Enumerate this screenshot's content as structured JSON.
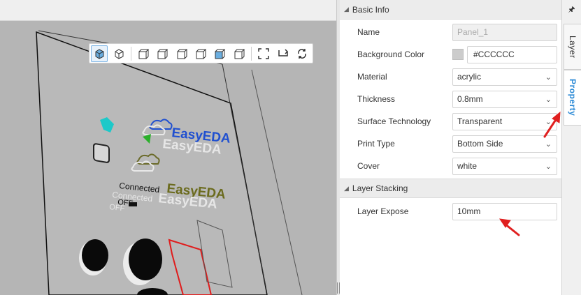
{
  "viewport": {
    "toolbar": {
      "buttons": [
        {
          "name": "view-3d-solid-icon",
          "active": true
        },
        {
          "name": "view-3d-wire-icon",
          "active": false
        },
        {
          "name": "view-front-icon",
          "active": false
        },
        {
          "name": "view-back-icon",
          "active": false
        },
        {
          "name": "view-left-icon",
          "active": false
        },
        {
          "name": "view-right-icon",
          "active": false
        },
        {
          "name": "view-top-icon",
          "active": false
        },
        {
          "name": "view-bottom-icon",
          "active": false
        },
        {
          "name": "fit-view-icon",
          "active": false
        },
        {
          "name": "flip-icon",
          "active": false
        },
        {
          "name": "refresh-icon",
          "active": false
        }
      ]
    },
    "scene": {
      "logo_text": "EasyEDA",
      "switch_label": "Connected",
      "switch_state": "OFF"
    }
  },
  "panel": {
    "basic_info": {
      "title": "Basic Info",
      "name_label": "Name",
      "name_value": "Panel_1",
      "bg_label": "Background Color",
      "bg_value": "#CCCCCC",
      "material_label": "Material",
      "material_value": "acrylic",
      "thickness_label": "Thickness",
      "thickness_value": "0.8mm",
      "surface_label": "Surface Technology",
      "surface_value": "Transparent",
      "print_label": "Print Type",
      "print_value": "Bottom Side",
      "cover_label": "Cover",
      "cover_value": "white"
    },
    "layer_stacking": {
      "title": "Layer Stacking",
      "expose_label": "Layer Expose",
      "expose_value": "10mm"
    }
  },
  "sidetabs": {
    "pin": "🖈",
    "layer": "Layer",
    "property": "Property"
  },
  "colors": {
    "accent": "#2b8ad6",
    "arrow": "#e02020",
    "swatch": "#cccccc"
  }
}
